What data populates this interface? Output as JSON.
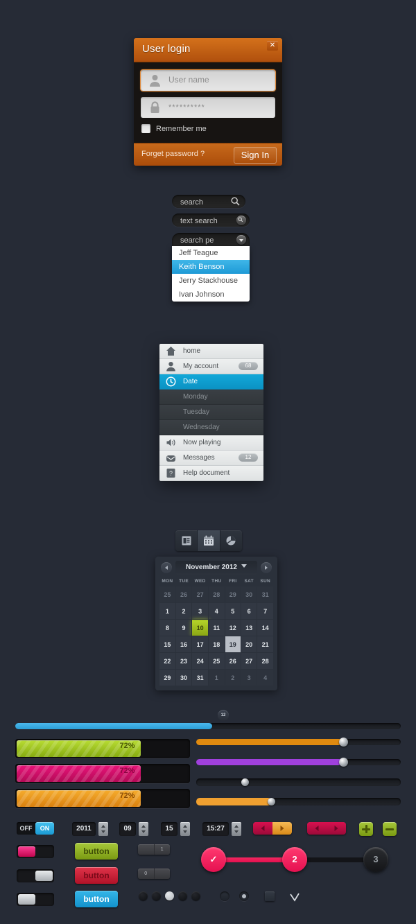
{
  "login": {
    "title": "User login",
    "close_label": "✕",
    "username_placeholder": "User name",
    "password_value": "**********",
    "remember_label": "Remember me",
    "forgot_label": "Forget password ?",
    "signin_label": "Sign In",
    "accent": "#c06012"
  },
  "search": {
    "bar1_value": "search",
    "bar2_value": "text search",
    "bar3_value": "search pe",
    "dropdown_options": [
      "Jeff Teague",
      "Keith Benson",
      "Jerry Stackhouse",
      "Ivan Johnson"
    ],
    "selected_index": 1
  },
  "menu": {
    "items": [
      {
        "label": "home",
        "icon": "home-icon",
        "style": "light",
        "badge": ""
      },
      {
        "label": "My account",
        "icon": "user-icon",
        "style": "light",
        "badge": "68"
      },
      {
        "label": "Date",
        "icon": "clock-icon",
        "style": "active",
        "badge": ""
      },
      {
        "label": "Monday",
        "icon": "",
        "style": "dark",
        "badge": ""
      },
      {
        "label": "Tuesday",
        "icon": "",
        "style": "dark",
        "badge": ""
      },
      {
        "label": "Wednesday",
        "icon": "",
        "style": "dark",
        "badge": ""
      },
      {
        "label": "Now playing",
        "icon": "speaker-icon",
        "style": "light",
        "badge": ""
      },
      {
        "label": "Messages",
        "icon": "mail-icon",
        "style": "light",
        "badge": "12"
      },
      {
        "label": "Help document",
        "icon": "help-icon",
        "style": "light",
        "badge": ""
      }
    ]
  },
  "tabs": {
    "items": [
      {
        "name": "list-icon",
        "active": false
      },
      {
        "name": "calendar-icon",
        "active": true
      },
      {
        "name": "pie-chart-icon",
        "active": false
      }
    ]
  },
  "calendar": {
    "month_label": "November 2012",
    "prev_label": "◀",
    "next_label": "▶",
    "weekdays": [
      "MON",
      "TUE",
      "WED",
      "THU",
      "FRI",
      "SAT",
      "SUN"
    ],
    "weeks": [
      [
        {
          "d": "25",
          "t": "mut"
        },
        {
          "d": "26",
          "t": "mut"
        },
        {
          "d": "27",
          "t": "mut"
        },
        {
          "d": "28",
          "t": "mut"
        },
        {
          "d": "29",
          "t": "mut"
        },
        {
          "d": "30",
          "t": "mut"
        },
        {
          "d": "31",
          "t": "mut"
        }
      ],
      [
        {
          "d": "1",
          "t": ""
        },
        {
          "d": "2",
          "t": ""
        },
        {
          "d": "3",
          "t": ""
        },
        {
          "d": "4",
          "t": ""
        },
        {
          "d": "5",
          "t": ""
        },
        {
          "d": "6",
          "t": ""
        },
        {
          "d": "7",
          "t": ""
        }
      ],
      [
        {
          "d": "8",
          "t": ""
        },
        {
          "d": "9",
          "t": ""
        },
        {
          "d": "10",
          "t": "hl"
        },
        {
          "d": "11",
          "t": ""
        },
        {
          "d": "12",
          "t": ""
        },
        {
          "d": "13",
          "t": ""
        },
        {
          "d": "14",
          "t": ""
        }
      ],
      [
        {
          "d": "15",
          "t": ""
        },
        {
          "d": "16",
          "t": ""
        },
        {
          "d": "17",
          "t": ""
        },
        {
          "d": "18",
          "t": ""
        },
        {
          "d": "19",
          "t": "sel"
        },
        {
          "d": "20",
          "t": ""
        },
        {
          "d": "21",
          "t": ""
        }
      ],
      [
        {
          "d": "22",
          "t": ""
        },
        {
          "d": "23",
          "t": ""
        },
        {
          "d": "24",
          "t": ""
        },
        {
          "d": "25",
          "t": ""
        },
        {
          "d": "26",
          "t": ""
        },
        {
          "d": "27",
          "t": ""
        },
        {
          "d": "28",
          "t": ""
        }
      ],
      [
        {
          "d": "29",
          "t": ""
        },
        {
          "d": "30",
          "t": ""
        },
        {
          "d": "31",
          "t": ""
        },
        {
          "d": "1",
          "t": "mut"
        },
        {
          "d": "2",
          "t": "mut"
        },
        {
          "d": "3",
          "t": "mut"
        },
        {
          "d": "4",
          "t": "mut"
        }
      ]
    ]
  },
  "sliders": {
    "top": {
      "value_label": "12",
      "percent": 51,
      "color": "#2a9ed6"
    },
    "rows": [
      {
        "percent": 72,
        "color": "#e08a10",
        "knob": true
      },
      {
        "percent": 72,
        "color": "#a040dd",
        "knob": true
      },
      {
        "percent": 24,
        "color": "",
        "knob": true
      },
      {
        "percent": 37,
        "color": "#f0a030",
        "knob": true
      }
    ]
  },
  "progress": {
    "bars": [
      {
        "percent": 72,
        "label": "72%",
        "color1": "#b8dc34",
        "color2": "#86ab10",
        "text_color": "#4b5a05"
      },
      {
        "percent": 72,
        "label": "72%",
        "color1": "#e8147a",
        "color2": "#b30a56",
        "text_color": "#8c0642"
      },
      {
        "percent": 72,
        "label": "72%",
        "color1": "#f6ad2e",
        "color2": "#d9800f",
        "text_color": "#8a4c04"
      }
    ]
  },
  "controls": {
    "toggle": {
      "off_label": "OFF",
      "on_label": "ON",
      "state": "on"
    },
    "switches": [
      {
        "color": "#ef1873",
        "position": "left"
      },
      {
        "color": "#cfd3d6",
        "position": "right"
      },
      {
        "color": "#d8dcdf",
        "position": "left"
      }
    ],
    "spinners": [
      {
        "value": "2011"
      },
      {
        "value": "09"
      },
      {
        "value": "15"
      },
      {
        "value": "15:27"
      }
    ],
    "buttons": [
      {
        "label": "button",
        "color1": "#a7c83a",
        "color2": "#7a9a12",
        "text_color": "#3e4d06"
      },
      {
        "label": "button",
        "color1": "#e0344a",
        "color2": "#b01228",
        "text_color": "#7a0a19"
      },
      {
        "label": "button",
        "color1": "#35b6e8",
        "color2": "#1392cc",
        "text_color": "#ffffff"
      }
    ],
    "arrow_pairs": [
      {
        "left_color": "#d8104f",
        "right_color": "#f0a83c",
        "left_glyph": "◀",
        "right_glyph": "▶"
      },
      {
        "left_color": "#d8104f",
        "right_color": "#d8104f",
        "left_glyph": "◀",
        "right_glyph": "▶"
      }
    ],
    "plus_minus": [
      {
        "name": "plus-button",
        "glyph": "+",
        "color1": "#a7c83a",
        "color2": "#7a9a12"
      },
      {
        "name": "minus-button",
        "glyph": "−",
        "color1": "#a7c83a",
        "color2": "#7a9a12"
      }
    ],
    "mini_steppers": [
      {
        "left": "",
        "right": "1"
      },
      {
        "left": "0",
        "right": ""
      }
    ],
    "stepper": {
      "nodes": [
        {
          "label": "✓",
          "state": "done"
        },
        {
          "label": "2",
          "state": "active"
        },
        {
          "label": "3",
          "state": "idle"
        }
      ],
      "active_color": "#e51050"
    },
    "dots": [
      {
        "state": "off"
      },
      {
        "state": "off"
      },
      {
        "state": "on"
      },
      {
        "state": "off"
      },
      {
        "state": "off"
      }
    ],
    "radios": [
      {
        "checked": false
      },
      {
        "checked": true
      }
    ],
    "checkboxes": [
      {
        "checked": false
      },
      {
        "checked": true
      }
    ]
  }
}
